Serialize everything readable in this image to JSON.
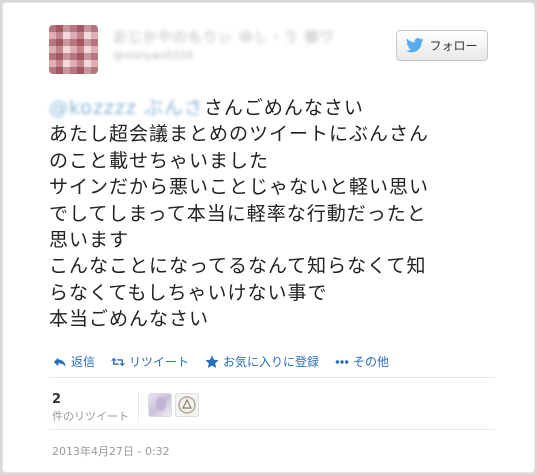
{
  "header": {
    "display_name": "おじかやのもりぃ ゆし・う 郁ワ",
    "screen_name": "@miriyan0326",
    "follow_label": "フォロー",
    "follow_icon": "twitter-bird-icon"
  },
  "tweet": {
    "mention": "@kozzzz ぶんさ",
    "line1_rest": "さんごめんなさい",
    "lines": [
      "あたし超会議まとめのツイートにぶんさん",
      "のこと載せちゃいました",
      "サインだから悪いことじゃないと軽い思い",
      "でしてしまって本当に軽率な行動だったと",
      "思います",
      "こんなことになってるなんて知らなくて知",
      "らなくてもしちゃいけない事で",
      "本当ごめんなさい"
    ]
  },
  "actions": {
    "reply": "返信",
    "retweet": "リツイート",
    "favorite": "お気に入りに登録",
    "more": "その他"
  },
  "stats": {
    "retweet_count": "2",
    "retweet_label": "件のリツイート"
  },
  "timestamp": "2013年4月27日 - 0:32",
  "colors": {
    "link": "#2a6ebb",
    "text": "#222222",
    "muted": "#999999"
  }
}
